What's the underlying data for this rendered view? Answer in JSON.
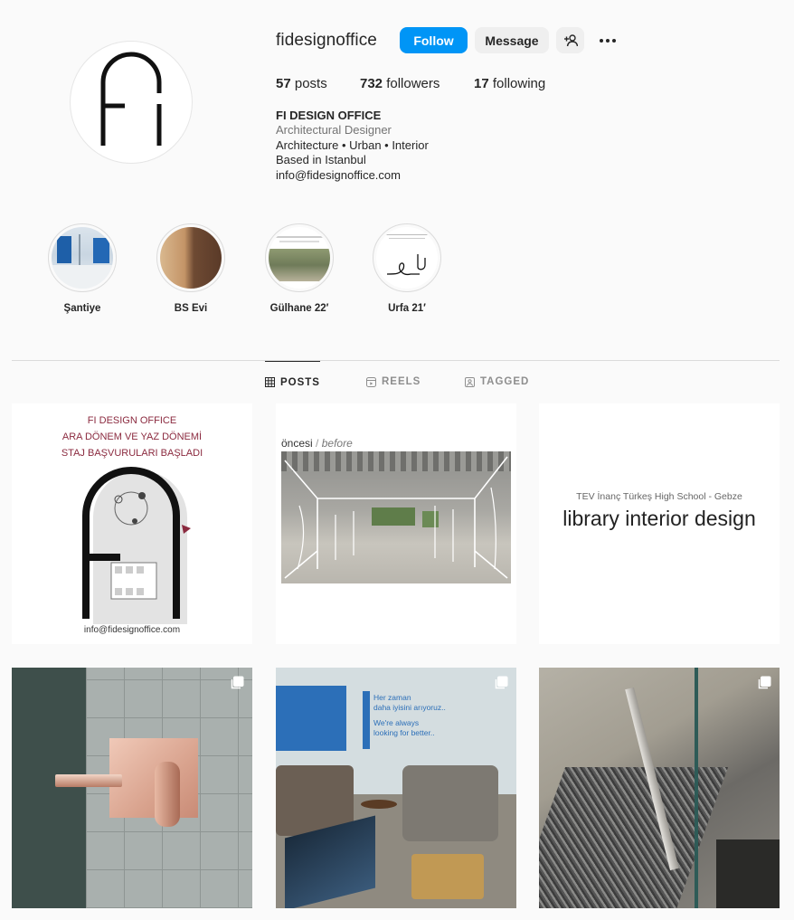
{
  "profile": {
    "username": "fidesignoffice",
    "follow_label": "Follow",
    "message_label": "Message",
    "stats": {
      "posts_count": "57",
      "posts_label": "posts",
      "followers_count": "732",
      "followers_label": "followers",
      "following_count": "17",
      "following_label": "following"
    },
    "bio": {
      "name": "FI DESIGN OFFICE",
      "category": "Architectural Designer",
      "line1": "Architecture • Urban • Interior",
      "line2": "Based in Istanbul",
      "email": "info@fidesignoffice.com"
    }
  },
  "highlights": [
    {
      "label": "Şantiye"
    },
    {
      "label": "BS Evi"
    },
    {
      "label": "Gülhane 22′"
    },
    {
      "label": "Urfa 21′"
    }
  ],
  "tabs": [
    {
      "label": "POSTS",
      "icon": "grid-icon",
      "active": true
    },
    {
      "label": "REELS",
      "icon": "reels-icon",
      "active": false
    },
    {
      "label": "TAGGED",
      "icon": "tagged-icon",
      "active": false
    }
  ],
  "posts": [
    {
      "line1": "FI DESIGN OFFICE",
      "line2": "ARA DÖNEM VE YAZ DÖNEMİ",
      "line3": "STAJ BAŞVURULARI BAŞLADI",
      "email": "info@fidesignoffice.com"
    },
    {
      "label_tr": "öncesi",
      "separator": "/",
      "label_en": "before"
    },
    {
      "subtitle": "TEV İnanç Türkeş High School - Gebze",
      "title": "library interior design"
    },
    {
      "multi": true
    },
    {
      "multi": true,
      "sign_line1": "Her zaman",
      "sign_line2": "daha iyisini arıyoruz..",
      "sign_line3": "We're always",
      "sign_line4": "looking for better.."
    },
    {
      "multi": true
    }
  ],
  "colors": {
    "follow_blue": "#0095f6",
    "background": "#fafafa",
    "accent_maroon": "#8b2a3f"
  }
}
